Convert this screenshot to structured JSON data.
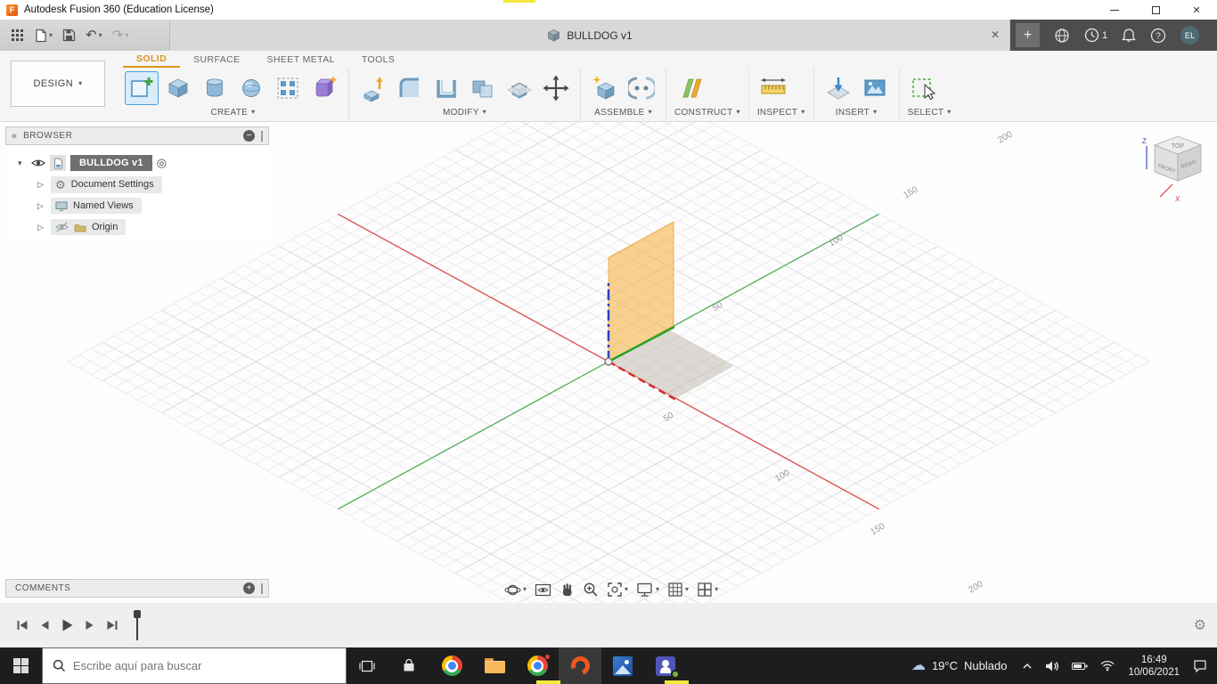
{
  "window": {
    "title": "Autodesk Fusion 360 (Education License)"
  },
  "app_bar": {
    "doc_tab": {
      "title": "BULLDOG v1"
    },
    "job_badge": "1",
    "avatar": "EL"
  },
  "ribbon": {
    "design_label": "DESIGN",
    "tabs": [
      {
        "label": "SOLID",
        "active": true
      },
      {
        "label": "SURFACE",
        "active": false
      },
      {
        "label": "SHEET METAL",
        "active": false
      },
      {
        "label": "TOOLS",
        "active": false
      }
    ],
    "groups": [
      {
        "label": "CREATE"
      },
      {
        "label": "MODIFY"
      },
      {
        "label": "ASSEMBLE"
      },
      {
        "label": "CONSTRUCT"
      },
      {
        "label": "INSPECT"
      },
      {
        "label": "INSERT"
      },
      {
        "label": "SELECT"
      }
    ]
  },
  "browser": {
    "header": "BROWSER",
    "root_label": "BULLDOG v1",
    "items": [
      {
        "label": "Document Settings"
      },
      {
        "label": "Named Views"
      },
      {
        "label": "Origin"
      }
    ]
  },
  "viewport": {
    "grid_labels_upper": [
      "50",
      "100",
      "150",
      "200"
    ],
    "grid_labels_lower": [
      "50",
      "100",
      "150",
      "200"
    ],
    "viewcube": {
      "top": "TOP",
      "front": "FRONT",
      "right": "RIGHT",
      "axis_z": "Z",
      "axis_x": "X"
    }
  },
  "comments": {
    "header": "COMMENTS"
  },
  "taskbar": {
    "search_placeholder": "Escribe aquí para buscar",
    "weather_temp": "19°C",
    "weather_desc": "Nublado",
    "time": "16:49",
    "date": "10/06/2021"
  },
  "icons": {
    "caret": "▾",
    "collapse": "«",
    "close": "✕",
    "plus": "+",
    "minus": "−",
    "gear": "⚙",
    "expand_arrow": "▷",
    "root_arrow": "▾",
    "undo": "↶",
    "redo": "↷",
    "cloud": "☁",
    "target": "◎",
    "question": "?"
  }
}
